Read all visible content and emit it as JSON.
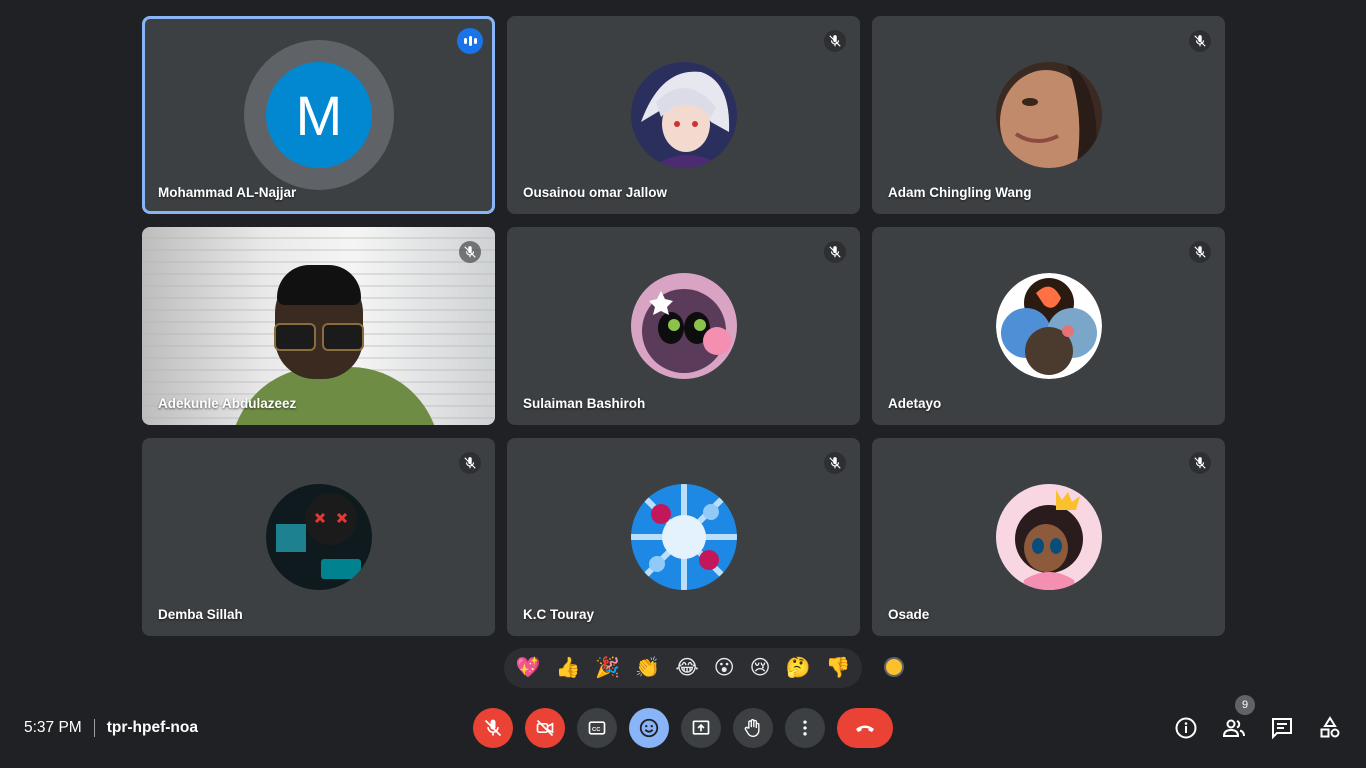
{
  "participants": [
    {
      "name": "Mohammad AL-Najjar",
      "initial": "M",
      "speaking": true
    },
    {
      "name": "Ousainou omar Jallow",
      "muted": true
    },
    {
      "name": "Adam Chingling Wang",
      "muted": true
    },
    {
      "name": "Adekunle Abdulazeez",
      "muted": true,
      "video": true
    },
    {
      "name": "Sulaiman Bashiroh",
      "muted": true
    },
    {
      "name": "Adetayo",
      "muted": true
    },
    {
      "name": "Demba Sillah",
      "muted": true
    },
    {
      "name": "K.C Touray",
      "muted": true
    },
    {
      "name": "Osade",
      "muted": true
    }
  ],
  "reactions": [
    "💖",
    "👍",
    "🎉",
    "👏",
    "😂",
    "😮",
    "😢",
    "🤔",
    "👎"
  ],
  "meeting": {
    "time": "5:37 PM",
    "code": "tpr-hpef-noa"
  },
  "people_count": "9",
  "colors": {
    "background": "#202124",
    "tile": "#3c4043",
    "accent": "#8ab4f8",
    "danger": "#ea4335"
  },
  "controls": [
    "mic-off-icon",
    "camera-off-icon",
    "captions-icon",
    "emoji-icon",
    "present-icon",
    "raise-hand-icon",
    "more-options-icon",
    "end-call-icon"
  ],
  "right_controls": [
    "info-icon",
    "people-icon",
    "chat-icon",
    "activities-icon"
  ]
}
